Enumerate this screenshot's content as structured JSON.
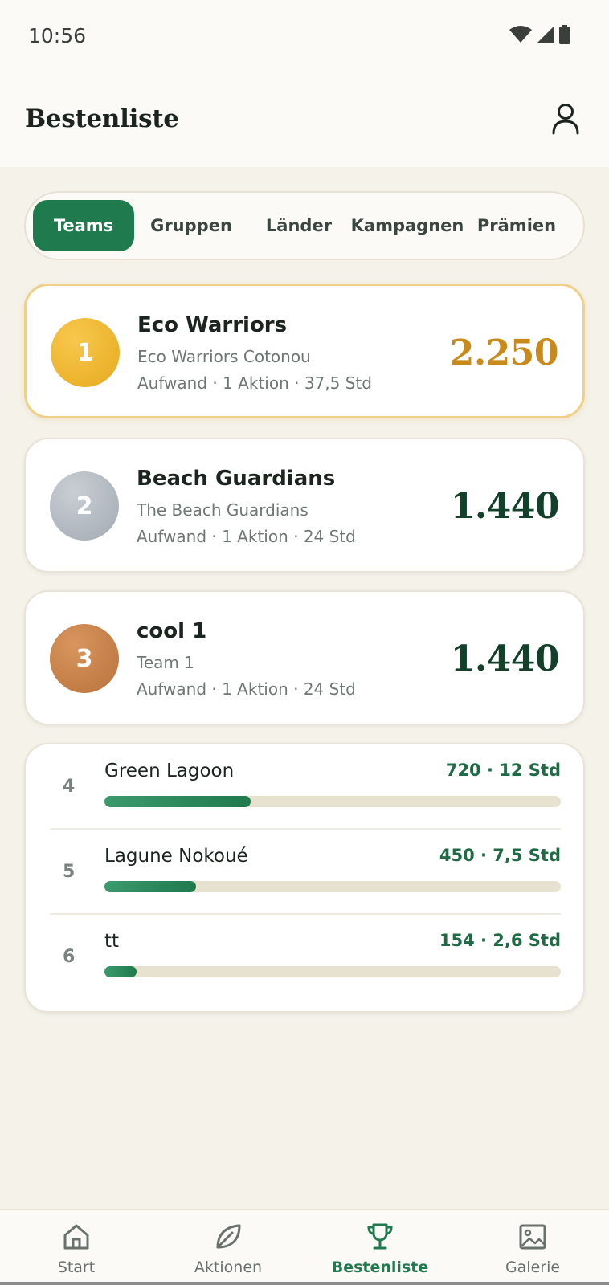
{
  "status_bar": {
    "time": "10:56"
  },
  "header": {
    "title": "Bestenliste"
  },
  "tabs": [
    {
      "label": "Teams",
      "active": true
    },
    {
      "label": "Gruppen",
      "active": false
    },
    {
      "label": "Länder",
      "active": false
    },
    {
      "label": "Kampagnen",
      "active": false
    },
    {
      "label": "Prämien",
      "active": false
    }
  ],
  "podium": [
    {
      "rank": "1",
      "name": "Eco Warriors",
      "subtitle": "Eco Warriors Cotonou",
      "meta": "Aufwand · 1 Aktion · 37,5 Std",
      "score": "2.250"
    },
    {
      "rank": "2",
      "name": "Beach Guardians",
      "subtitle": "The Beach Guardians",
      "meta": "Aufwand · 1 Aktion · 24 Std",
      "score": "1.440"
    },
    {
      "rank": "3",
      "name": "cool 1",
      "subtitle": "Team 1",
      "meta": "Aufwand · 1 Aktion · 24 Std",
      "score": "1.440"
    }
  ],
  "rest": [
    {
      "rank": "4",
      "name": "Green Lagoon",
      "stat": "720 · 12 Std",
      "progress": 0.32
    },
    {
      "rank": "5",
      "name": "Lagune Nokoué",
      "stat": "450 · 7,5 Std",
      "progress": 0.2
    },
    {
      "rank": "6",
      "name": "tt",
      "stat": "154 · 2,6 Std",
      "progress": 0.07
    }
  ],
  "bottom_nav": [
    {
      "label": "Start",
      "icon": "home-icon",
      "active": false
    },
    {
      "label": "Aktionen",
      "icon": "leaf-icon",
      "active": false
    },
    {
      "label": "Bestenliste",
      "icon": "trophy-icon",
      "active": true
    },
    {
      "label": "Galerie",
      "icon": "image-icon",
      "active": false
    }
  ],
  "colors": {
    "accent": "#1f7a4d",
    "gold": "#c98a1c",
    "score": "#13402b",
    "background": "#f5f2ea"
  }
}
